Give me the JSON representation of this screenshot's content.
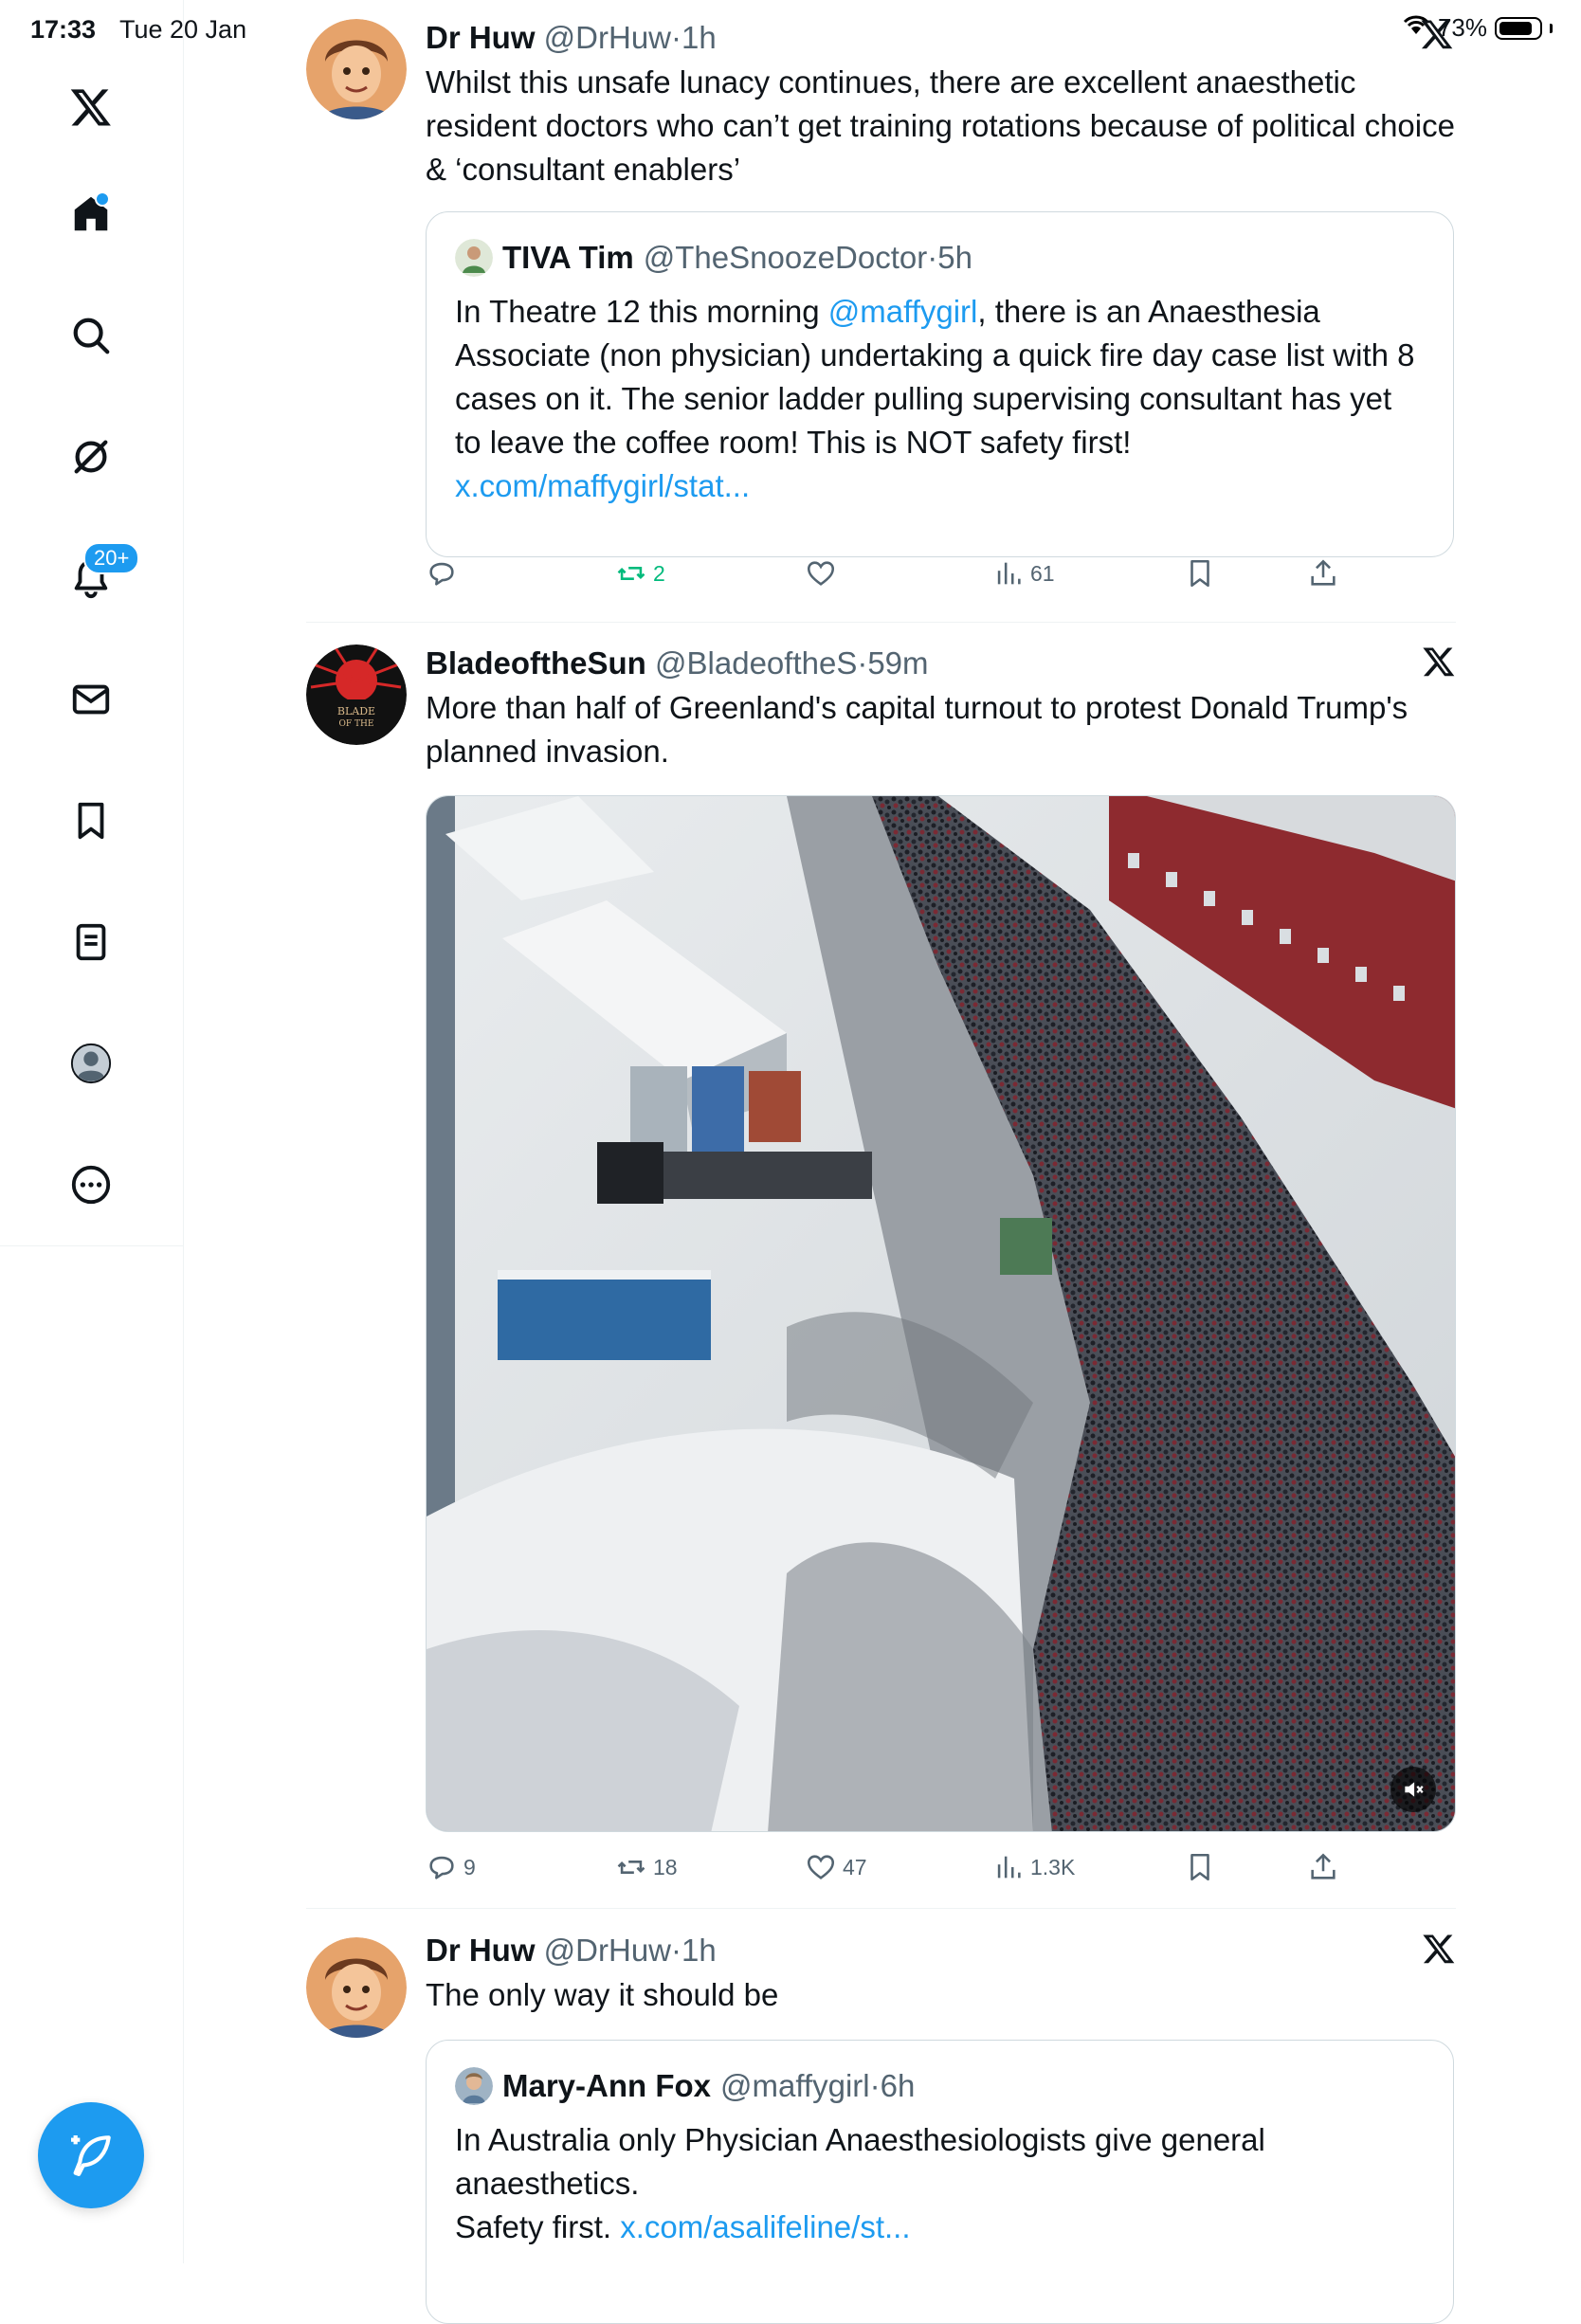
{
  "status_bar": {
    "time": "17:33",
    "date": "Tue 20 Jan",
    "battery": "73%"
  },
  "sidebar": {
    "items": [
      {
        "name": "x-logo-icon"
      },
      {
        "name": "home-icon",
        "has_dot": true
      },
      {
        "name": "search-icon"
      },
      {
        "name": "grok-icon"
      },
      {
        "name": "notifications-icon",
        "badge": "20+"
      },
      {
        "name": "messages-icon"
      },
      {
        "name": "bookmarks-icon"
      },
      {
        "name": "lists-icon"
      },
      {
        "name": "profile-icon"
      },
      {
        "name": "more-icon"
      }
    ]
  },
  "colors": {
    "accent": "#1d9bf0",
    "muted": "#536471",
    "retweet_green": "#00ba7c"
  },
  "tweets": [
    {
      "name": "Dr Huw",
      "handle": "@DrHuw",
      "time": "1h",
      "text": "Whilst this unsafe lunacy continues, there are excellent anaesthetic resident doctors who can’t get training rotations because of political choice & ‘consultant enablers’",
      "quote": {
        "name": "TIVA Tim",
        "handle": "@TheSnoozeDoctor",
        "time": "5h",
        "text_pre": "In Theatre 12 this morning ",
        "mention": "@maffygirl",
        "text_post": ", there is an Anaesthesia Associate (non physician) undertaking a quick fire day case list with 8 cases on it. The senior ladder pulling supervising consultant has yet to leave the coffee room! This is NOT safety first! ",
        "link": "x.com/maffygirl/stat..."
      },
      "actions": {
        "replies": "",
        "retweets": "2",
        "likes": "",
        "views": "61"
      }
    },
    {
      "name": "BladeoftheSun",
      "handle": "@BladeoftheS",
      "time": "59m",
      "avatar_text": "BLADE OF THE",
      "text": "More than half of Greenland's capital turnout to protest Donald Trump's planned invasion.",
      "media": {
        "type": "video",
        "muted": true
      },
      "actions": {
        "replies": "9",
        "retweets": "18",
        "likes": "47",
        "views": "1.3K"
      }
    },
    {
      "name": "Dr Huw",
      "handle": "@DrHuw",
      "time": "1h",
      "text": "The only way it should be",
      "quote": {
        "name": "Mary-Ann Fox",
        "handle": "@maffygirl",
        "time": "6h",
        "text_line1": "In Australia only Physician Anaesthesiologists give general anaesthetics.",
        "text_line2": "Safety first. ",
        "link": "x.com/asalifeline/st..."
      }
    }
  ],
  "separator": "·"
}
